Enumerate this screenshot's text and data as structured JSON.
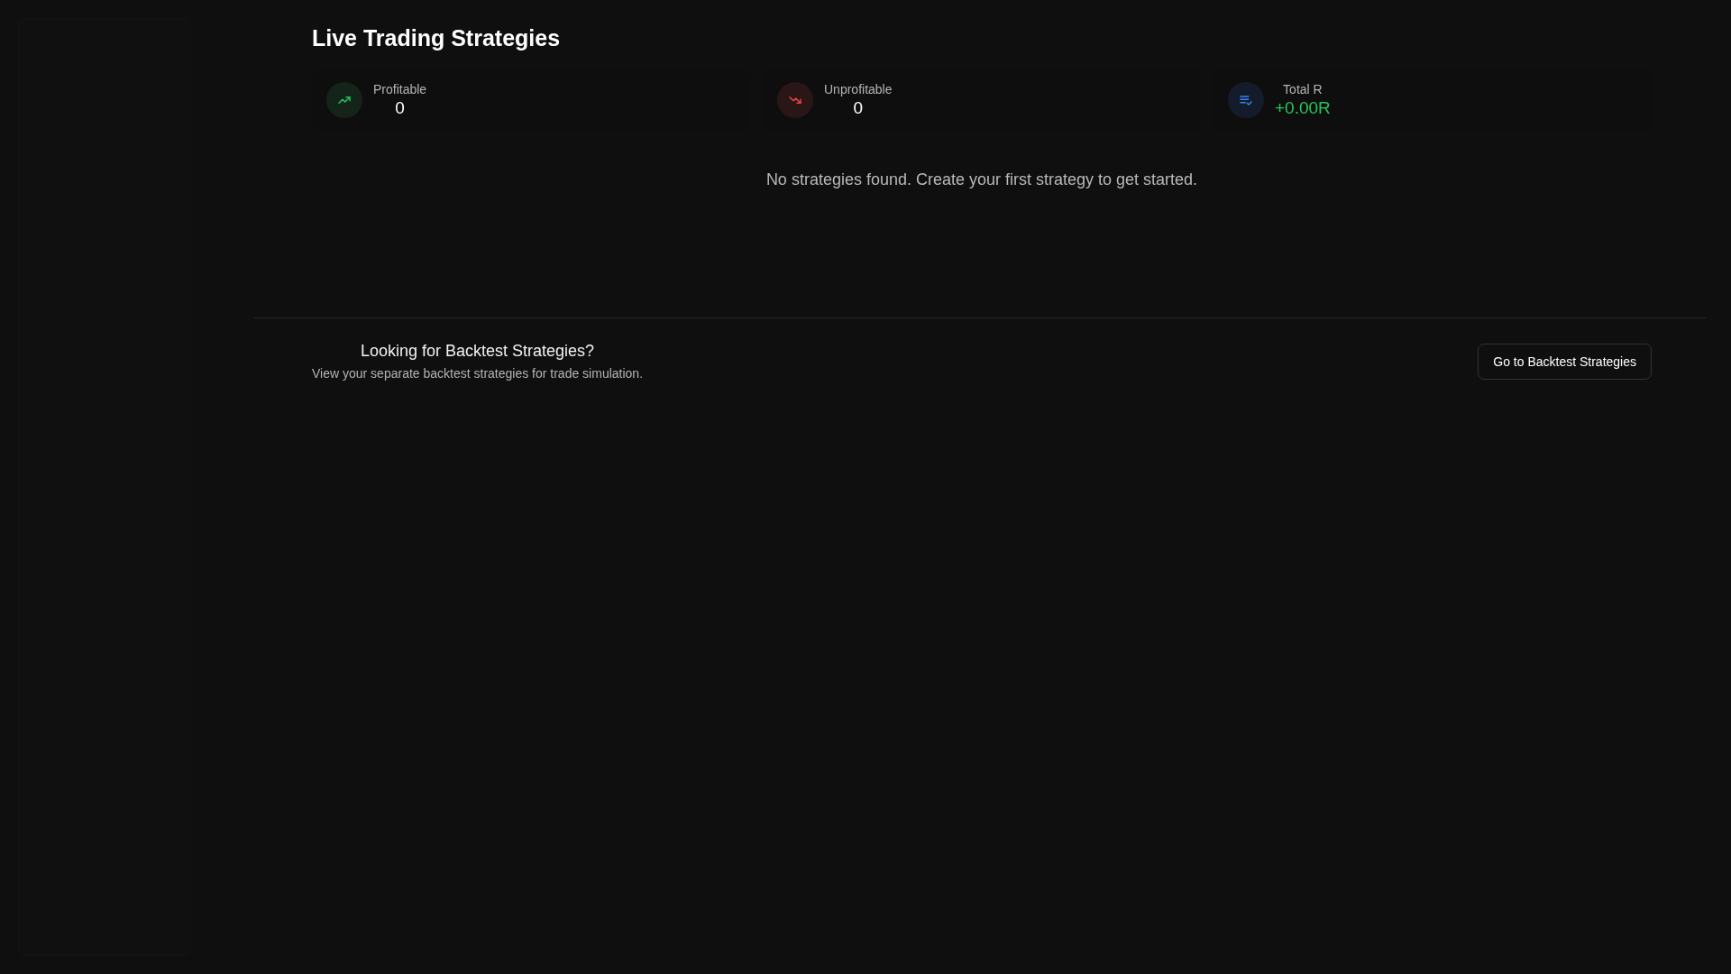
{
  "page": {
    "title": "Live Trading Strategies"
  },
  "stats": [
    {
      "kind": "up",
      "label": "Profitable",
      "value": "0"
    },
    {
      "kind": "down",
      "label": "Unprofitable",
      "value": "0"
    },
    {
      "kind": "total",
      "label": "Total R",
      "value": "+0.00R"
    }
  ],
  "empty_message": "No strategies found. Create your first strategy to get started.",
  "backtest_prompt": {
    "heading": "Looking for Backtest Strategies?",
    "description": "View your separate backtest strategies for trade simulation.",
    "button": "Go to Backtest Strategies"
  }
}
